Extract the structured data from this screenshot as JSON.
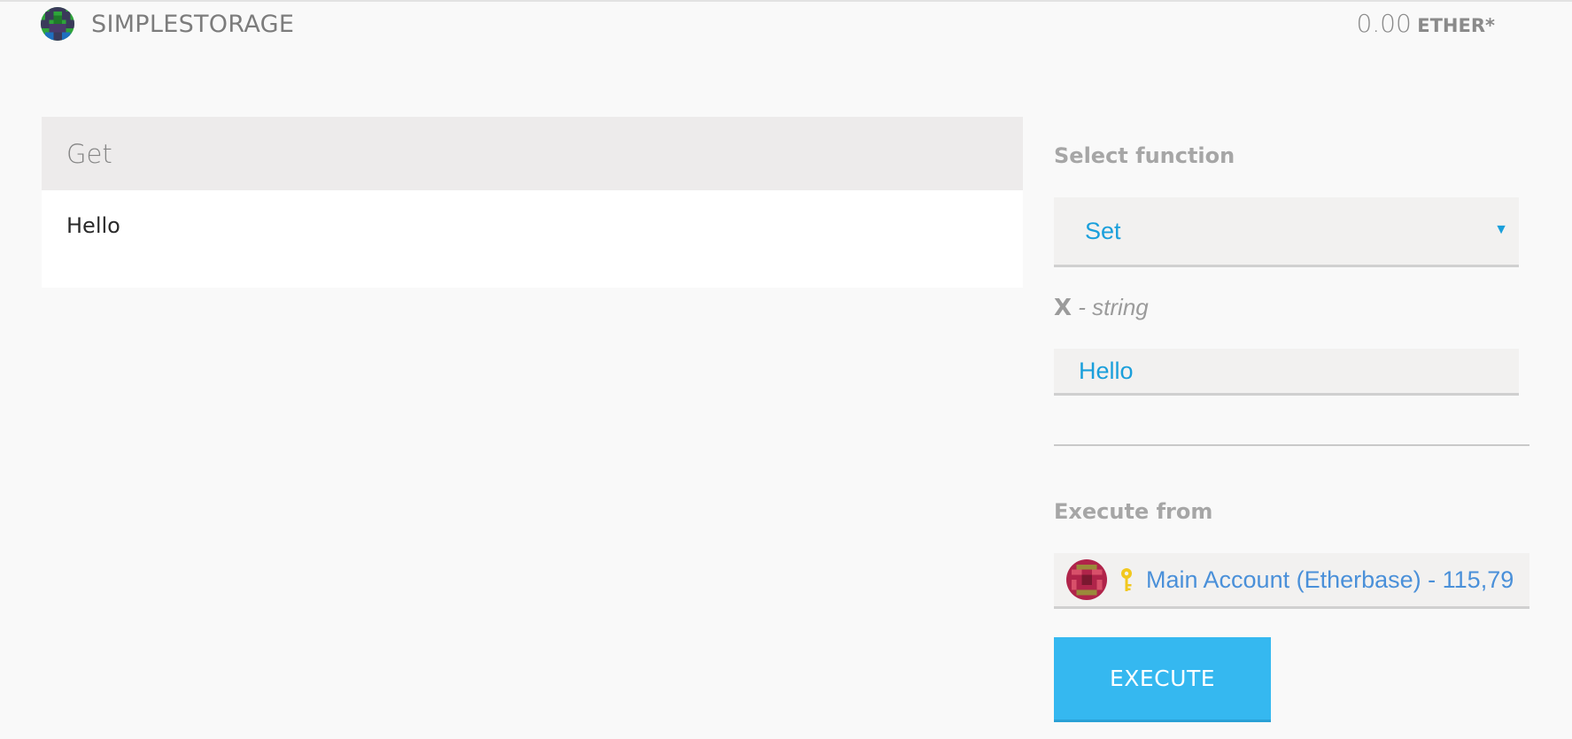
{
  "header": {
    "contract_name": "SIMPLESTORAGE",
    "balance_amount": "0.00",
    "balance_unit": "ETHER*"
  },
  "read_panel": {
    "function_name": "Get",
    "result_value": "Hello"
  },
  "write_panel": {
    "select_function_label": "Select function",
    "selected_function": "Set",
    "param_name": "X",
    "param_separator": " - ",
    "param_type": "string",
    "param_value": "Hello",
    "execute_from_label": "Execute from",
    "account_text": "Main Account (Etherbase) - 115,79",
    "execute_label": "EXECUTE"
  },
  "icons": {
    "contract_identicon": "identicon-green",
    "account_identicon": "identicon-red",
    "key": "key-icon",
    "dropdown_arrow": "triangle-down-icon"
  },
  "colors": {
    "accent": "#1a9fdb",
    "execute_button": "#35b8f0",
    "account_text": "#4a90d9"
  }
}
